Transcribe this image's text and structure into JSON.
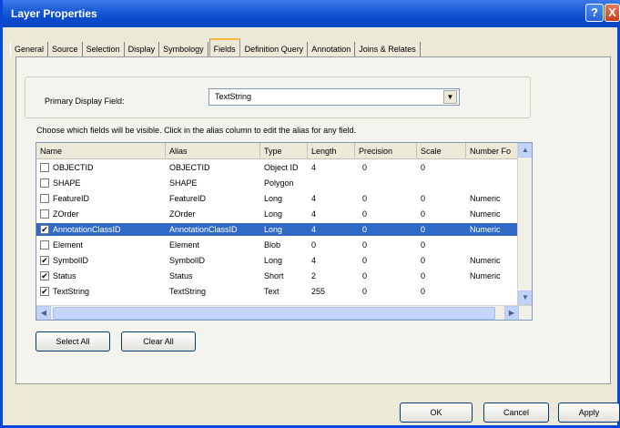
{
  "window": {
    "title": "Layer Properties"
  },
  "tabs": [
    {
      "label": "General"
    },
    {
      "label": "Source"
    },
    {
      "label": "Selection"
    },
    {
      "label": "Display"
    },
    {
      "label": "Symbology"
    },
    {
      "label": "Fields",
      "active": true
    },
    {
      "label": "Definition Query"
    },
    {
      "label": "Annotation"
    },
    {
      "label": "Joins & Relates"
    }
  ],
  "primary_display": {
    "label": "Primary Display Field:",
    "value": "TextString"
  },
  "instructions": "Choose which fields will be visible. Click in the alias column to edit the alias for any field.",
  "table": {
    "columns": [
      "Name",
      "Alias",
      "Type",
      "Length",
      "Precision",
      "Scale",
      "Number Fo"
    ],
    "rows": [
      {
        "checked": false,
        "name": "OBJECTID",
        "alias": "OBJECTID",
        "type": "Object ID",
        "length": "4",
        "precision": "0",
        "scale": "0",
        "numfmt": ""
      },
      {
        "checked": false,
        "name": "SHAPE",
        "alias": "SHAPE",
        "type": "Polygon",
        "length": "",
        "precision": "",
        "scale": "",
        "numfmt": ""
      },
      {
        "checked": false,
        "name": "FeatureID",
        "alias": "FeatureID",
        "type": "Long",
        "length": "4",
        "precision": "0",
        "scale": "0",
        "numfmt": "Numeric"
      },
      {
        "checked": false,
        "name": "ZOrder",
        "alias": "ZOrder",
        "type": "Long",
        "length": "4",
        "precision": "0",
        "scale": "0",
        "numfmt": "Numeric"
      },
      {
        "checked": true,
        "selected": true,
        "name": "AnnotationClassID",
        "alias": "AnnotationClassID",
        "type": "Long",
        "length": "4",
        "precision": "0",
        "scale": "0",
        "numfmt": "Numeric"
      },
      {
        "checked": false,
        "name": "Element",
        "alias": "Element",
        "type": "Blob",
        "length": "0",
        "precision": "0",
        "scale": "0",
        "numfmt": ""
      },
      {
        "checked": true,
        "name": "SymbolID",
        "alias": "SymbolID",
        "type": "Long",
        "length": "4",
        "precision": "0",
        "scale": "0",
        "numfmt": "Numeric"
      },
      {
        "checked": true,
        "name": "Status",
        "alias": "Status",
        "type": "Short",
        "length": "2",
        "precision": "0",
        "scale": "0",
        "numfmt": "Numeric"
      },
      {
        "checked": true,
        "name": "TextString",
        "alias": "TextString",
        "type": "Text",
        "length": "255",
        "precision": "0",
        "scale": "0",
        "numfmt": ""
      }
    ]
  },
  "buttons": {
    "select_all": "Select All",
    "clear_all": "Clear All",
    "ok": "OK",
    "cancel": "Cancel",
    "apply": "Apply"
  },
  "icons": {
    "help": "?",
    "close": "X",
    "combo_arrow": "▼",
    "check": "✔"
  },
  "colors": {
    "titlebar": "#0a4acb",
    "selection": "#316ac5",
    "dialog_bg": "#ece9d8"
  }
}
